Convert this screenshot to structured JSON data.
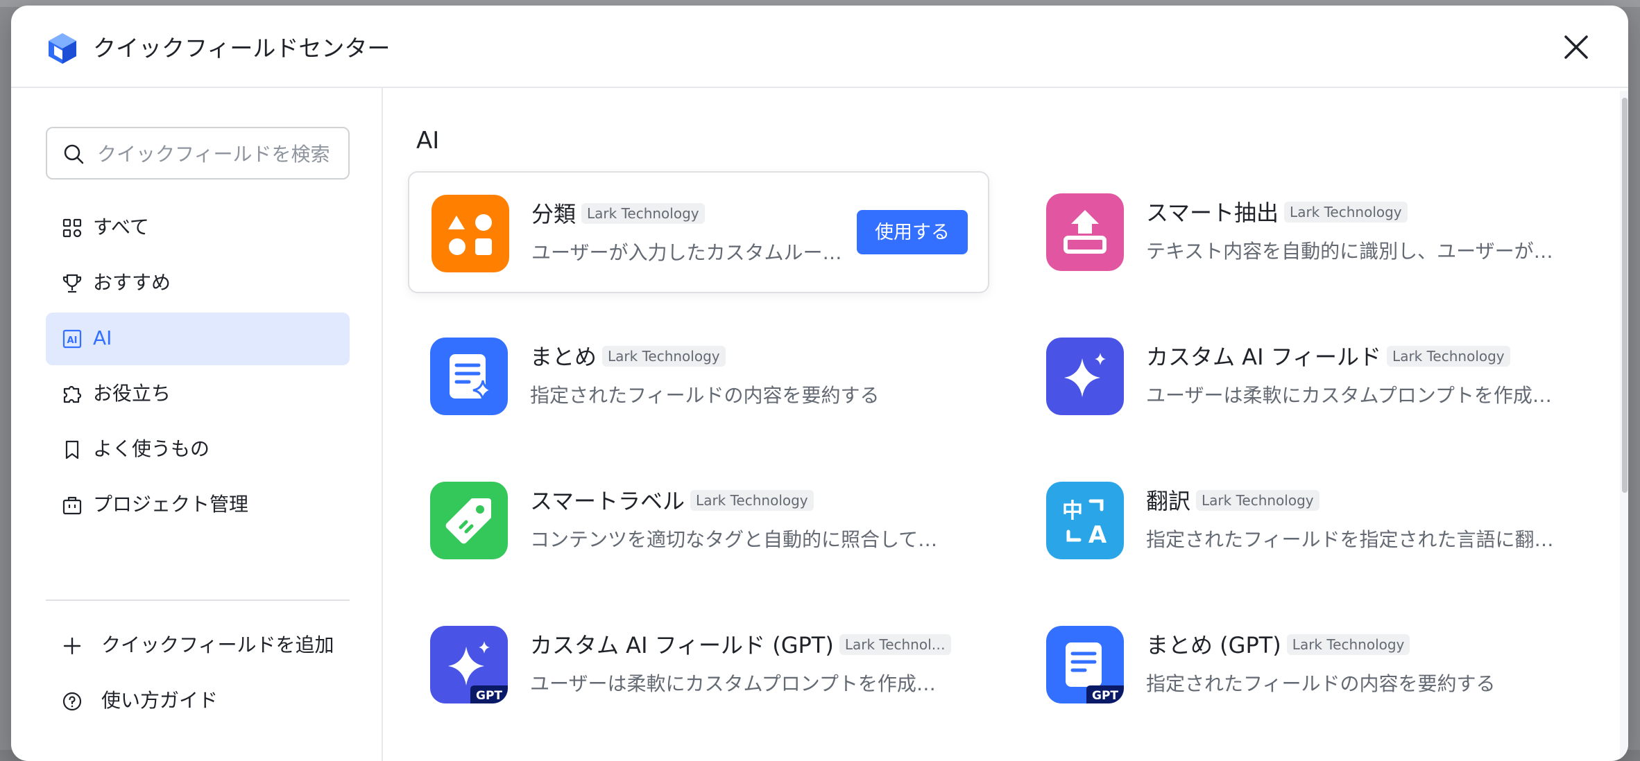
{
  "header": {
    "title": "クイックフィールドセンター"
  },
  "search": {
    "placeholder": "クイックフィールドを検索"
  },
  "sidebar": {
    "items": [
      {
        "label": "すべて",
        "icon": "grid-icon"
      },
      {
        "label": "おすすめ",
        "icon": "trophy-icon"
      },
      {
        "label": "AI",
        "icon": "ai-icon",
        "active": true
      },
      {
        "label": "お役立ち",
        "icon": "puzzle-icon"
      },
      {
        "label": "よく使うもの",
        "icon": "bookmark-icon"
      },
      {
        "label": "プロジェクト管理",
        "icon": "briefcase-icon"
      }
    ],
    "footer": [
      {
        "label": "クイックフィールドを追加",
        "icon": "plus-icon"
      },
      {
        "label": "使い方ガイド",
        "icon": "help-icon"
      }
    ]
  },
  "main": {
    "section_title": "AI",
    "use_button_label": "使用する",
    "cards": [
      {
        "name": "分類",
        "badge": "Lark Technology",
        "desc": "ユーザーが入力したカスタムルー…",
        "color": "#ff8000"
      },
      {
        "name": "スマート抽出",
        "badge": "Lark Technology",
        "desc": "テキスト内容を自動的に識別し、ユーザーが…",
        "color": "#e255a1"
      },
      {
        "name": "まとめ",
        "badge": "Lark Technology",
        "desc": "指定されたフィールドの内容を要約する",
        "color": "#3370ff"
      },
      {
        "name": "カスタム AI フィールド",
        "badge": "Lark Technology",
        "desc": "ユーザーは柔軟にカスタムプロンプトを作成…",
        "color": "#4954e6"
      },
      {
        "name": "スマートラベル",
        "badge": "Lark Technology",
        "desc": "コンテンツを適切なタグと自動的に照合して…",
        "color": "#34c759"
      },
      {
        "name": "翻訳",
        "badge": "Lark Technology",
        "desc": "指定されたフィールドを指定された言語に翻…",
        "color": "#2aa6e8"
      },
      {
        "name": "カスタム AI フィールド (GPT)",
        "badge": "Lark Technol…",
        "desc": "ユーザーは柔軟にカスタムプロンプトを作成…",
        "color": "#4954e6",
        "corner": "GPT"
      },
      {
        "name": "まとめ (GPT)",
        "badge": "Lark Technology",
        "desc": "指定されたフィールドの内容を要約する",
        "color": "#3370ff",
        "corner": "GPT"
      }
    ]
  }
}
